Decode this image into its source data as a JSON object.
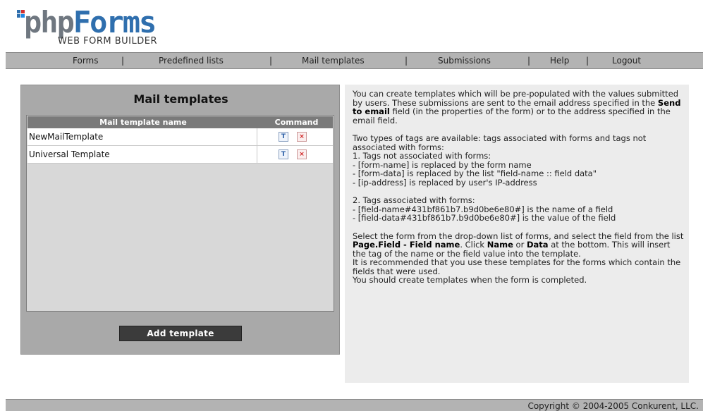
{
  "logo": {
    "word_plain": "php",
    "word_brand": "Forms",
    "subtitle": "WEB FORM BUILDER",
    "dot_colors": [
      "#2f6fae",
      "#d32f2f",
      "#2f6fae",
      "#1e88e5"
    ]
  },
  "nav": {
    "items": [
      {
        "label": "Forms"
      },
      {
        "label": "Predefined lists"
      },
      {
        "label": "Mail templates"
      },
      {
        "label": "Submissions"
      },
      {
        "label": "Help"
      },
      {
        "label": "Logout"
      }
    ],
    "separator": "|"
  },
  "templates": {
    "title": "Mail templates",
    "col_name": "Mail template name",
    "col_command": "Command",
    "rows": [
      {
        "name": "NewMailTemplate",
        "edit_icon": "edit-icon",
        "delete_icon": "delete-icon"
      },
      {
        "name": "Universal Template",
        "edit_icon": "edit-icon",
        "delete_icon": "delete-icon"
      }
    ],
    "edit_glyph": "T",
    "delete_glyph": "×",
    "add_button": "Add template"
  },
  "info": {
    "p1a": "You can create templates which will be pre-populated with the values submitted by users. These submissions are sent to the email address specified in the ",
    "p1b": "Send to email",
    "p1c": " field (in the properties of the form) or to the address specified in the email field.",
    "p2": "Two types of tags are available: tags associated with forms and tags not associated with forms:\n1. Tags not associated with forms:\n- [form-name] is replaced by the form name\n- [form-data] is replaced by the list \"field-name :: field data\"\n- [ip-address] is replaced by user's IP-address",
    "p3": "2. Tags associated with forms:\n- [field-name#431bf861b7.b9d0be6e80#] is the name of a field\n- [field-data#431bf861b7.b9d0be6e80#] is the value of the field",
    "p4a": "Select the form from the drop-down list of forms, and select the field from the list ",
    "p4b": "Page.Field - Field name",
    "p4c": ". Click ",
    "p4d": "Name",
    "p4e": " or ",
    "p4f": "Data",
    "p4g": " at the bottom. This will insert the tag of the name or the field value into the template.\nIt is recommended that you use these templates for the forms which contain the fields that were used.\nYou should create templates when the form is completed."
  },
  "footer": {
    "copyright": "Copyright © 2004-2005 Conkurent, LLC."
  }
}
